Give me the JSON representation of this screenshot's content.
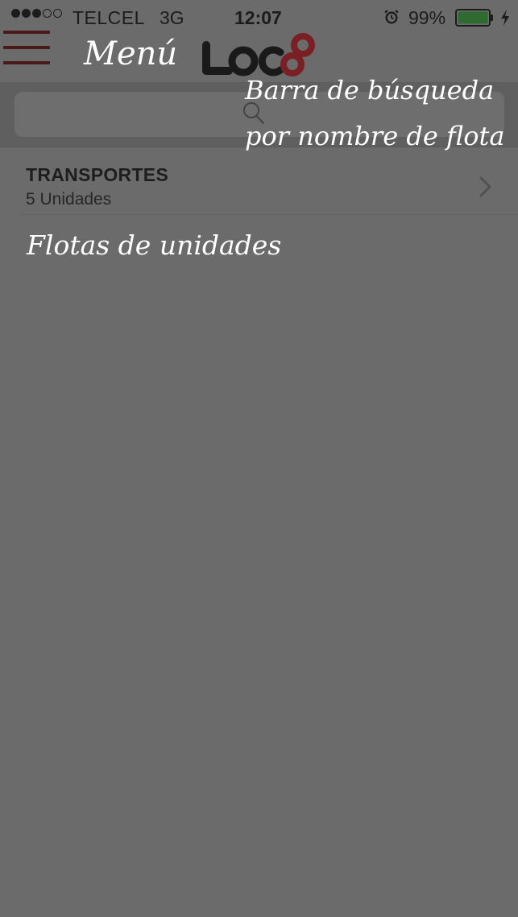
{
  "status_bar": {
    "carrier": "TELCEL",
    "network": "3G",
    "time": "12:07",
    "battery": "99%",
    "signal_bars_filled": 3,
    "signal_bars_total": 5,
    "icons": [
      "signal-dots-icon",
      "alarm-icon",
      "battery-icon",
      "charging-bolt-icon"
    ]
  },
  "nav": {
    "menu_icon": "hamburger-menu-icon",
    "logo": "loc8-logo"
  },
  "search": {
    "placeholder": "",
    "icon": "search-icon"
  },
  "fleets": [
    {
      "name": "TRANSPORTES",
      "count": "5 Unidades"
    }
  ],
  "annotations": {
    "menu": "Menú",
    "search_line1": "Barra de búsqueda",
    "search_line2": "por nombre de flota",
    "fleets": "Flotas de unidades"
  },
  "colors": {
    "overlay": "#6b6b6b",
    "brand_red": "#7a1f24",
    "logo_dark": "#1a1a1a",
    "battery_green": "#2f7a32",
    "annotation_text": "#ffffff"
  }
}
